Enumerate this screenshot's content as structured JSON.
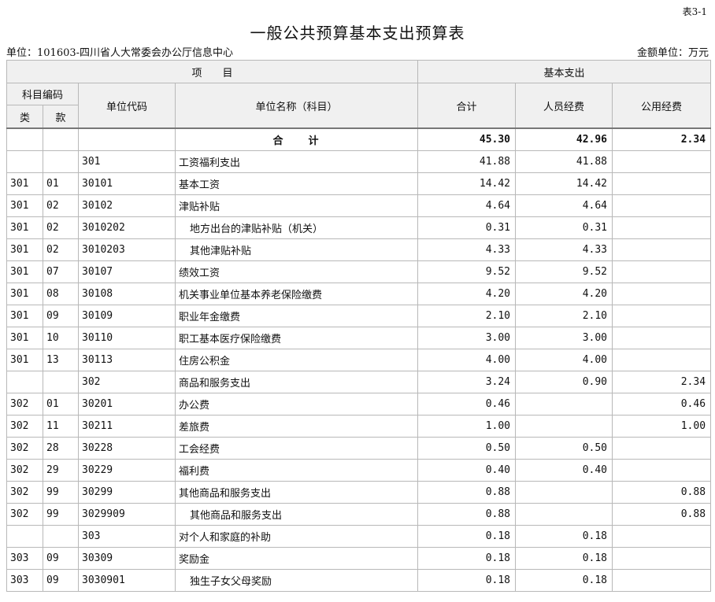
{
  "header": {
    "table_no": "表3-1",
    "title": "一般公共预算基本支出预算表",
    "unit": "单位：101603-四川省人大常委会办公厅信息中心",
    "amount_unit": "金额单位：万元"
  },
  "columns": {
    "project": "项　　目",
    "basic": "基本支出",
    "subject_code": "科目编码",
    "unit_code": "单位代码",
    "unit_name": "单位名称（科目）",
    "total": "合计",
    "personnel": "人员经费",
    "public": "公用经费",
    "class": "类",
    "section": "款"
  },
  "total_row": {
    "label": "合　　计",
    "total": "45.30",
    "personnel": "42.96",
    "public": "2.34"
  },
  "rows": [
    {
      "lei": "",
      "kuan": "",
      "code": "301",
      "name": "工资福利支出",
      "total": "41.88",
      "personnel": "41.88",
      "public": "",
      "indent": false
    },
    {
      "lei": "301",
      "kuan": "01",
      "code": "30101",
      "name": "基本工资",
      "total": "14.42",
      "personnel": "14.42",
      "public": "",
      "indent": false
    },
    {
      "lei": "301",
      "kuan": "02",
      "code": "30102",
      "name": "津贴补贴",
      "total": "4.64",
      "personnel": "4.64",
      "public": "",
      "indent": false
    },
    {
      "lei": "301",
      "kuan": "02",
      "code": "3010202",
      "name": "地方出台的津贴补贴（机关）",
      "total": "0.31",
      "personnel": "0.31",
      "public": "",
      "indent": true
    },
    {
      "lei": "301",
      "kuan": "02",
      "code": "3010203",
      "name": "其他津贴补贴",
      "total": "4.33",
      "personnel": "4.33",
      "public": "",
      "indent": true
    },
    {
      "lei": "301",
      "kuan": "07",
      "code": "30107",
      "name": "绩效工资",
      "total": "9.52",
      "personnel": "9.52",
      "public": "",
      "indent": false
    },
    {
      "lei": "301",
      "kuan": "08",
      "code": "30108",
      "name": "机关事业单位基本养老保险缴费",
      "total": "4.20",
      "personnel": "4.20",
      "public": "",
      "indent": false
    },
    {
      "lei": "301",
      "kuan": "09",
      "code": "30109",
      "name": "职业年金缴费",
      "total": "2.10",
      "personnel": "2.10",
      "public": "",
      "indent": false
    },
    {
      "lei": "301",
      "kuan": "10",
      "code": "30110",
      "name": "职工基本医疗保险缴费",
      "total": "3.00",
      "personnel": "3.00",
      "public": "",
      "indent": false
    },
    {
      "lei": "301",
      "kuan": "13",
      "code": "30113",
      "name": "住房公积金",
      "total": "4.00",
      "personnel": "4.00",
      "public": "",
      "indent": false
    },
    {
      "lei": "",
      "kuan": "",
      "code": "302",
      "name": "商品和服务支出",
      "total": "3.24",
      "personnel": "0.90",
      "public": "2.34",
      "indent": false
    },
    {
      "lei": "302",
      "kuan": "01",
      "code": "30201",
      "name": "办公费",
      "total": "0.46",
      "personnel": "",
      "public": "0.46",
      "indent": false
    },
    {
      "lei": "302",
      "kuan": "11",
      "code": "30211",
      "name": "差旅费",
      "total": "1.00",
      "personnel": "",
      "public": "1.00",
      "indent": false
    },
    {
      "lei": "302",
      "kuan": "28",
      "code": "30228",
      "name": "工会经费",
      "total": "0.50",
      "personnel": "0.50",
      "public": "",
      "indent": false
    },
    {
      "lei": "302",
      "kuan": "29",
      "code": "30229",
      "name": "福利费",
      "total": "0.40",
      "personnel": "0.40",
      "public": "",
      "indent": false
    },
    {
      "lei": "302",
      "kuan": "99",
      "code": "30299",
      "name": "其他商品和服务支出",
      "total": "0.88",
      "personnel": "",
      "public": "0.88",
      "indent": false
    },
    {
      "lei": "302",
      "kuan": "99",
      "code": "3029909",
      "name": "其他商品和服务支出",
      "total": "0.88",
      "personnel": "",
      "public": "0.88",
      "indent": true
    },
    {
      "lei": "",
      "kuan": "",
      "code": "303",
      "name": "对个人和家庭的补助",
      "total": "0.18",
      "personnel": "0.18",
      "public": "",
      "indent": false
    },
    {
      "lei": "303",
      "kuan": "09",
      "code": "30309",
      "name": "奖励金",
      "total": "0.18",
      "personnel": "0.18",
      "public": "",
      "indent": false
    },
    {
      "lei": "303",
      "kuan": "09",
      "code": "3030901",
      "name": "独生子女父母奖励",
      "total": "0.18",
      "personnel": "0.18",
      "public": "",
      "indent": true
    }
  ]
}
